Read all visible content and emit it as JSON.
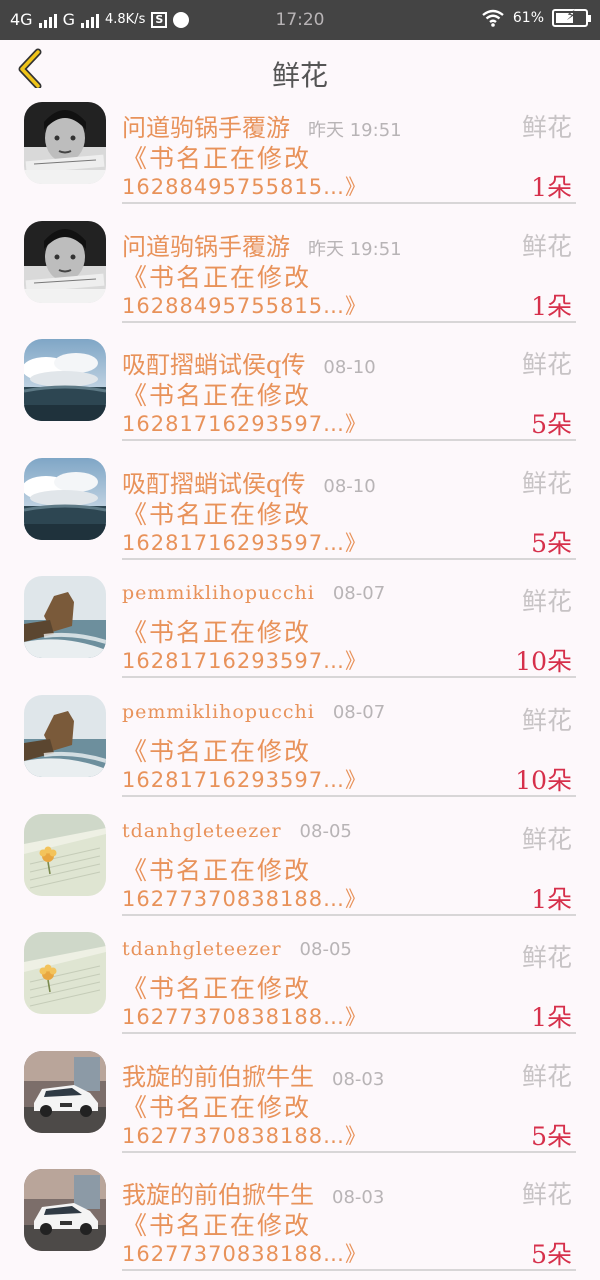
{
  "status_bar": {
    "network1": "4G",
    "network2": "G",
    "speed": "4.8K/s",
    "s_badge": "S",
    "time": "17:20",
    "battery": "61%",
    "battery_level": 0.61
  },
  "header": {
    "back_icon": "chevron-left-icon",
    "title": "鲜花"
  },
  "colors": {
    "accent": "#e8925a",
    "count_red": "#d6304b",
    "muted": "#c7c3c5",
    "back_yellow": "#f0c419"
  },
  "items": [
    {
      "avatar": "portrait-bw",
      "user": "问道驹锅手覆游",
      "time": "昨天 19:51",
      "book": "《书名正在修改",
      "id": "1628849575581​5…》",
      "label": "鲜花",
      "count": "1朵"
    },
    {
      "avatar": "portrait-bw",
      "user": "问道驹锅手覆游",
      "time": "昨天 19:51",
      "book": "《书名正在修改",
      "id": "1628849575581​5…》",
      "label": "鲜花",
      "count": "1朵"
    },
    {
      "avatar": "sky-sea",
      "user": "吸酊摺蛸试侯q传",
      "time": "08-10",
      "book": "《书名正在修改",
      "id": "1628171629359​7…》",
      "label": "鲜花",
      "count": "5朵"
    },
    {
      "avatar": "sky-sea",
      "user": "吸酊摺蛸试侯q传",
      "time": "08-10",
      "book": "《书名正在修改",
      "id": "1628171629359​7…》",
      "label": "鲜花",
      "count": "5朵"
    },
    {
      "avatar": "cliff-sea",
      "user": "pemmiklihopucchi",
      "time": "08-07",
      "book": "《书名正在修改",
      "id": "1628171629359​7…》",
      "label": "鲜花",
      "count": "10朵"
    },
    {
      "avatar": "cliff-sea",
      "user": "pemmiklihopucchi",
      "time": "08-07",
      "book": "《书名正在修改",
      "id": "1628171629359​7…》",
      "label": "鲜花",
      "count": "10朵"
    },
    {
      "avatar": "flower-paper",
      "user": "tdanhgleteezer",
      "time": "08-05",
      "book": "《书名正在修改",
      "id": "1627737083818​8…》",
      "label": "鲜花",
      "count": "1朵"
    },
    {
      "avatar": "flower-paper",
      "user": "tdanhgleteezer",
      "time": "08-05",
      "book": "《书名正在修改",
      "id": "1627737083818​8…》",
      "label": "鲜花",
      "count": "1朵"
    },
    {
      "avatar": "white-car",
      "user": "我旋的前伯掀牛生",
      "time": "08-03",
      "book": "《书名正在修改",
      "id": "1627737083818​8…》",
      "label": "鲜花",
      "count": "5朵"
    },
    {
      "avatar": "white-car",
      "user": "我旋的前伯掀牛生",
      "time": "08-03",
      "book": "《书名正在修改",
      "id": "1627737083818​8…》",
      "label": "鲜花",
      "count": "5朵"
    }
  ]
}
